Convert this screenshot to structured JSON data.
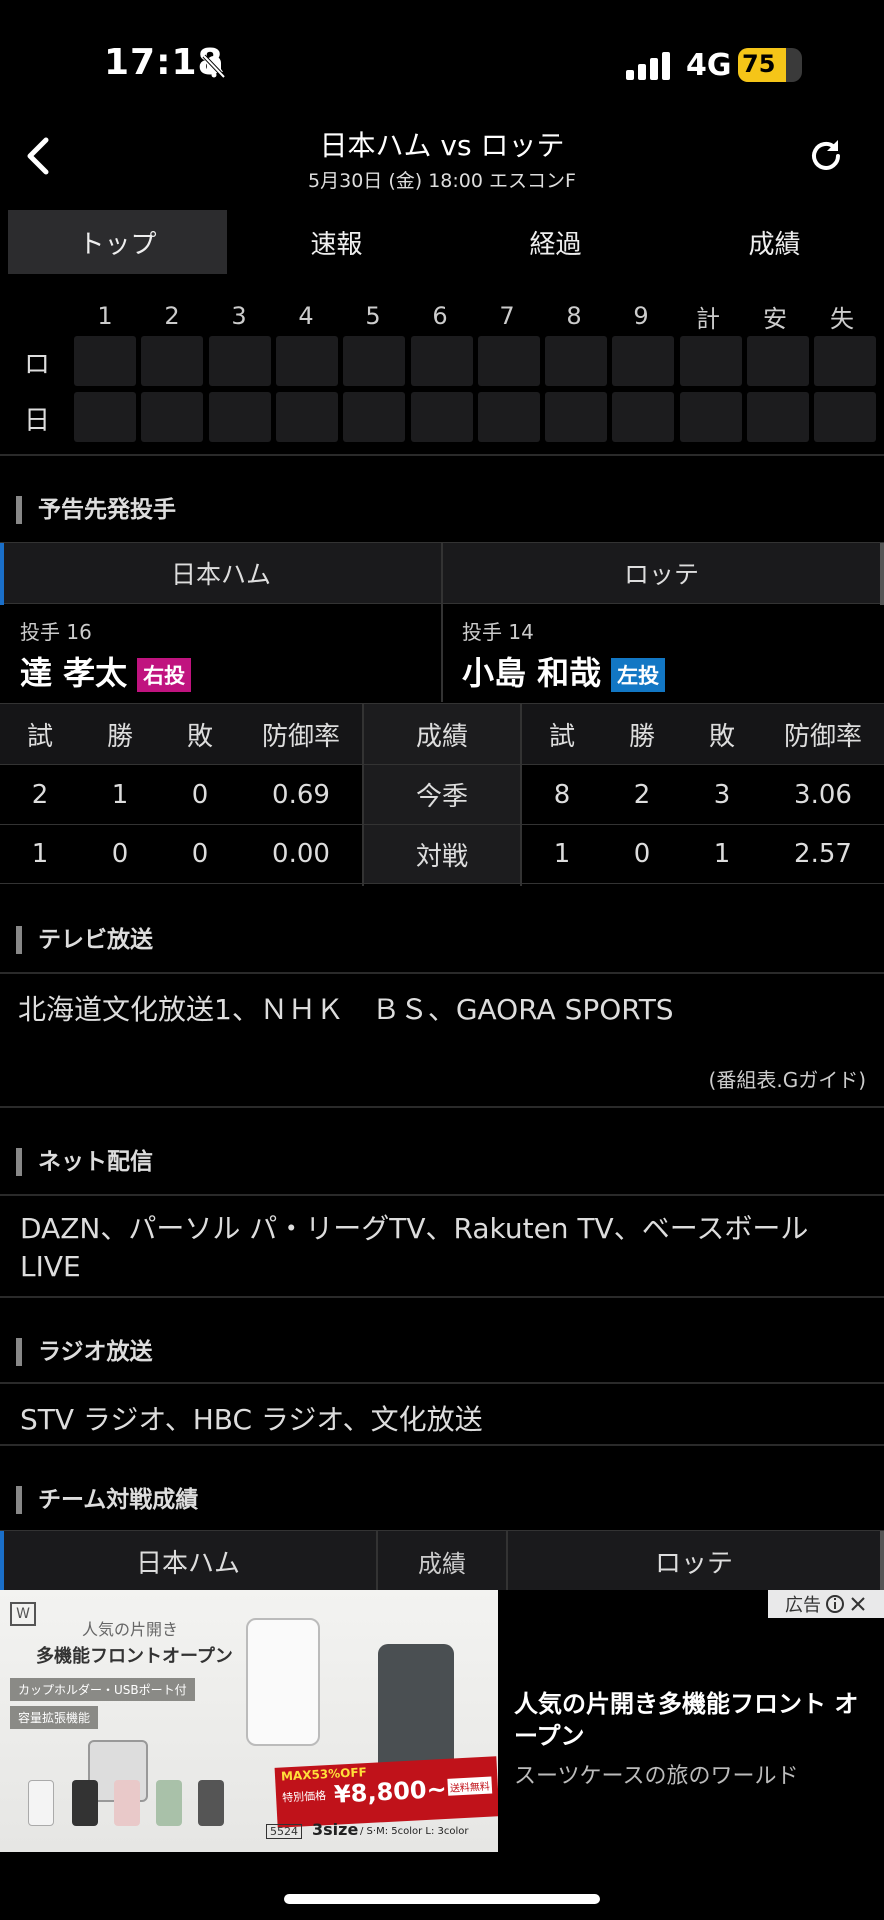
{
  "status": {
    "time": "17:18",
    "network": "4G",
    "battery": "75",
    "battery_level": 0.75
  },
  "header": {
    "title": "日本ハム vs ロッテ",
    "subtitle": "5月30日 (金) 18:00 エスコンF"
  },
  "tabs": [
    {
      "label": "トップ",
      "active": true
    },
    {
      "label": "速報",
      "active": false
    },
    {
      "label": "経過",
      "active": false
    },
    {
      "label": "成績",
      "active": false
    }
  ],
  "scoreboard": {
    "columns": [
      "1",
      "2",
      "3",
      "4",
      "5",
      "6",
      "7",
      "8",
      "9",
      "計",
      "安",
      "失"
    ],
    "teams": [
      "ロ",
      "日"
    ]
  },
  "pitchers": {
    "section_title": "予告先発投手",
    "home": {
      "team": "日本ハム",
      "number": "投手 16",
      "name": "達 孝太",
      "hand": "右投",
      "hand_color": "#c0137f"
    },
    "away": {
      "team": "ロッテ",
      "number": "投手 14",
      "name": "小島 和哉",
      "hand": "左投",
      "hand_color": "#1277c4"
    },
    "stat_headers": [
      "試",
      "勝",
      "敗",
      "防御率"
    ],
    "center_header": "成績",
    "rows": [
      {
        "label": "今季",
        "home": [
          "2",
          "1",
          "0",
          "0.69"
        ],
        "away": [
          "8",
          "2",
          "3",
          "3.06"
        ]
      },
      {
        "label": "対戦",
        "home": [
          "1",
          "0",
          "0",
          "0.00"
        ],
        "away": [
          "1",
          "0",
          "1",
          "2.57"
        ]
      }
    ]
  },
  "tv": {
    "section_title": "テレビ放送",
    "text": "北海道文化放送1、ＮＨＫ　ＢＳ、GAORA SPORTS",
    "source": "(番組表.Gガイド)"
  },
  "net": {
    "section_title": "ネット配信",
    "text": "DAZN、パーソル パ・リーグTV、Rakuten TV、ベースボール LIVE"
  },
  "radio": {
    "section_title": "ラジオ放送",
    "text": "STV ラジオ、HBC ラジオ、文化放送"
  },
  "matchup": {
    "section_title": "チーム対戦成績",
    "home": "日本ハム",
    "center": "成績",
    "away": "ロッテ"
  },
  "ad": {
    "label": "広告",
    "headline": "人気の片開き多機能フロント オープン",
    "description": "スーツケースの旅のワールド",
    "img_caption1": "人気の片開き",
    "img_caption2": "多機能フロントオープン",
    "img_tag1": "カップホルダー・USBポート付",
    "img_tag2": "容量拡張機能",
    "img_discount": "MAX53%OFF",
    "img_price": "¥8,800~",
    "img_price_label": "特別価格",
    "img_shipping": "送料無料",
    "img_code": "5524",
    "img_size": "3size",
    "img_size_detail": "/ S·M: 5color  L: 3color"
  }
}
